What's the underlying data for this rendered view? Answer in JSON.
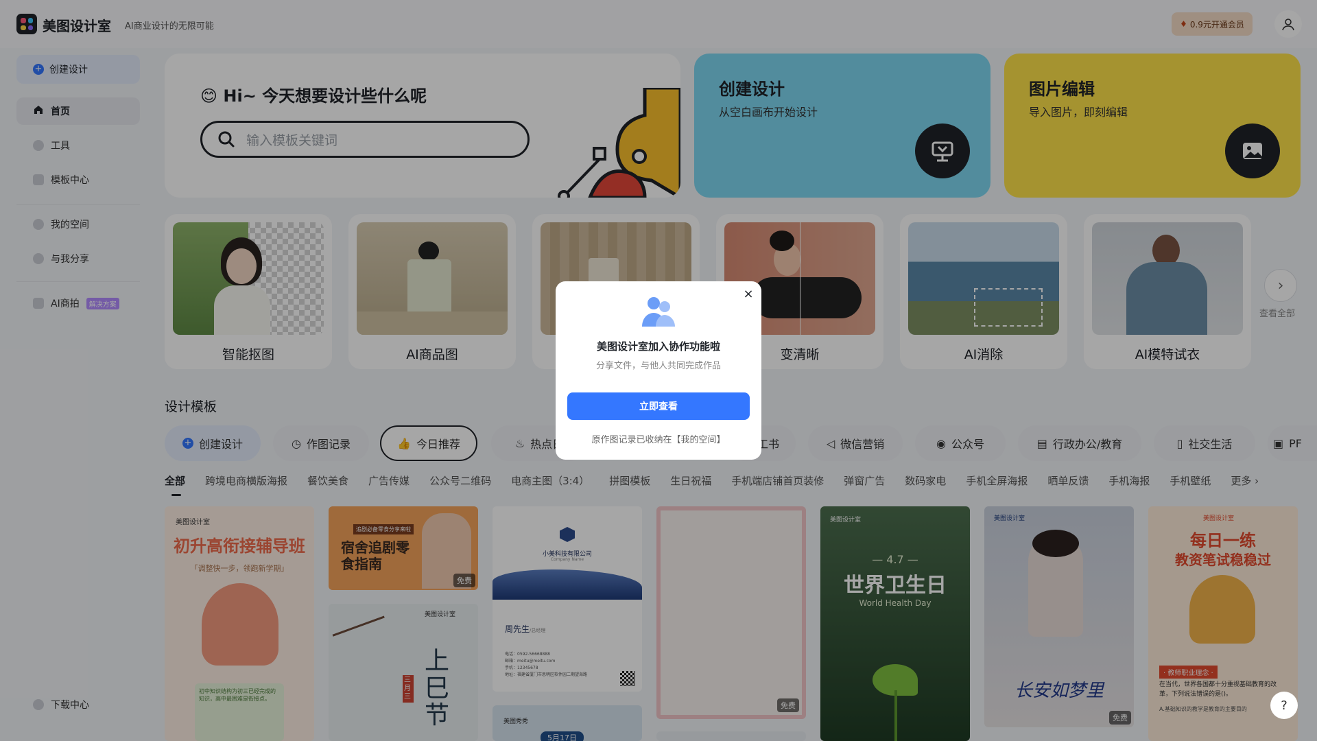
{
  "header": {
    "brand": "美图设计室",
    "slogan": "AI商业设计的无限可能",
    "vip_label": "0.9元开通会员"
  },
  "sidebar": {
    "create": "创建设计",
    "items": [
      {
        "label": "首页"
      },
      {
        "label": "工具"
      },
      {
        "label": "模板中心"
      },
      {
        "label": "我的空间"
      },
      {
        "label": "与我分享"
      },
      {
        "label": "AI商拍"
      }
    ],
    "new_badge": "解决方案",
    "download": "下载中心"
  },
  "hero": {
    "title": "Hi~ 今天想要设计些什么呢",
    "emoji": "😊",
    "search_placeholder": "输入模板关键词"
  },
  "cards": {
    "create": {
      "title": "创建设计",
      "subtitle": "从空白画布开始设计"
    },
    "edit": {
      "title": "图片编辑",
      "subtitle": "导入图片，即刻编辑"
    }
  },
  "tools": [
    {
      "label": "智能抠图"
    },
    {
      "label": "AI商品图"
    },
    {
      "label": ""
    },
    {
      "label": "变清晰"
    },
    {
      "label": "AI消除"
    },
    {
      "label": "AI模特试衣"
    }
  ],
  "more": {
    "label": "查看全部",
    "arrow": "›"
  },
  "templates": {
    "title": "设计模板",
    "chips": [
      {
        "label": "创建设计"
      },
      {
        "label": "作图记录"
      },
      {
        "label": "今日推荐"
      },
      {
        "label": "热点日"
      },
      {
        "label": "工书"
      },
      {
        "label": "微信营销"
      },
      {
        "label": "公众号"
      },
      {
        "label": "行政办公/教育"
      },
      {
        "label": "社交生活"
      },
      {
        "label": "PF"
      }
    ],
    "categories": [
      "全部",
      "跨境电商横版海报",
      "餐饮美食",
      "广告传媒",
      "公众号二维码",
      "电商主图（3:4）",
      "拼图模板",
      "生日祝福",
      "手机端店铺首页装修",
      "弹窗广告",
      "数码家电",
      "手机全屏海报",
      "晒单反馈",
      "手机海报",
      "手机壁纸",
      "更多 ›"
    ],
    "free_tag": "免费",
    "cards": [
      {
        "brand": "美图设计室",
        "title": "初升高衔接辅导班",
        "subtitle": "「调整快一步，领跑新学期」",
        "note": "初中知识结构为初三已经完成的知识，高中最困难是衔接点。"
      },
      {
        "title": "宿舍追剧零食指南",
        "tag": "追剧必备零食分享来啦"
      },
      {
        "brand": "美图设计室",
        "title": "上巳节",
        "seal": "三月三"
      },
      {
        "company": "小美科技有限公司",
        "company_en": "Company Name",
        "person": "周先生",
        "role": "/总经理",
        "line1": "电话：0592-56668888",
        "line2": "邮箱：meitu@meitu.com",
        "line3": "手机：12345678",
        "line4": "地址：福建省厦门市思明区软件园二期望海路"
      },
      {
        "brand": "美图秀秀",
        "date": "5月17日"
      },
      {},
      {
        "brand": "美图设计室",
        "date": "— 4.7 —",
        "title": "世界卫生日",
        "subtitle": "World Health Day"
      },
      {
        "brand": "美图设计室",
        "title": "长安如梦里"
      },
      {
        "brand": "美图设计室",
        "title": "每日一练",
        "subtitle": "教资笔试稳稳过",
        "section": "· 教师职业理念 ·",
        "body": "在当代，世界各国都十分重视基础教育的改革，下列说法错误的是()。",
        "option": "A.基础知识的教学是教育的主要目的"
      }
    ]
  },
  "modal": {
    "title": "美图设计室加入协作功能啦",
    "subtitle": "分享文件，与他人共同完成作品",
    "button": "立即查看",
    "note": "原作图记录已收纳在【我的空间】",
    "close": "×"
  },
  "help": "?",
  "colors": {
    "accent": "#3477ff",
    "card_blue": "#7fd8f1",
    "card_yellow": "#fde24a"
  }
}
